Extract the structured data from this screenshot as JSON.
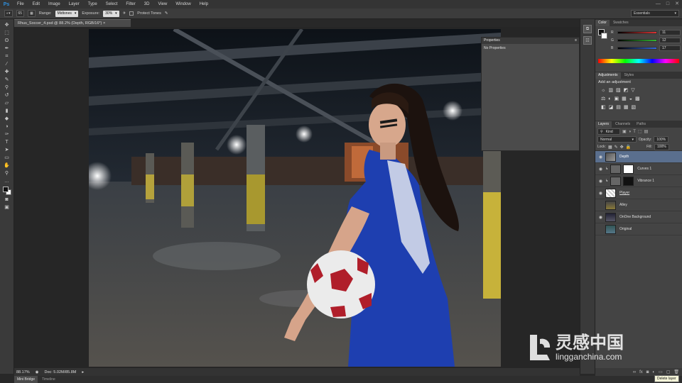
{
  "app": {
    "logo": "Ps"
  },
  "menu": [
    "File",
    "Edit",
    "Image",
    "Layer",
    "Type",
    "Select",
    "Filter",
    "3D",
    "View",
    "Window",
    "Help"
  ],
  "window_controls": [
    "—",
    "□",
    "✕"
  ],
  "options_bar": {
    "brush_size": "65",
    "range_label": "Range:",
    "range_value": "Midtones",
    "exposure_label": "Exposure:",
    "exposure_value": "30%",
    "protect_tones_label": "Protect Tones"
  },
  "workspace": "Essentials",
  "document_tab": "Rhus_Soccer_4.psd @ 88.2% (Depth, RGB/16*)",
  "status": {
    "zoom": "88.17%",
    "doc": "Doc: 5.02M/85.8M"
  },
  "bottom_tabs": [
    "Mini Bridge",
    "Timeline"
  ],
  "properties_panel": {
    "title": "Properties",
    "content": "No Properties"
  },
  "color_panel": {
    "tabs": [
      "Color",
      "Swatches"
    ],
    "channels": [
      {
        "name": "R",
        "value": "11",
        "color": "#d33"
      },
      {
        "name": "G",
        "value": "12",
        "color": "#3b3"
      },
      {
        "name": "B",
        "value": "17",
        "color": "#36d"
      }
    ]
  },
  "adjustments_panel": {
    "tabs": [
      "Adjustments",
      "Styles"
    ],
    "heading": "Add an adjustment",
    "row1": [
      "☼",
      "▥",
      "▨",
      "◩",
      "▽"
    ],
    "row2": [
      "⚖",
      "◐",
      "▣",
      "▦",
      "◒",
      "▩"
    ],
    "row3": [
      "◧",
      "◪",
      "▤",
      "▦",
      "▧"
    ]
  },
  "layers_panel": {
    "tabs": [
      "Layers",
      "Channels",
      "Paths"
    ],
    "filter": "Kind",
    "blend_mode": "Normal",
    "opacity_label": "Opacity:",
    "opacity": "100%",
    "lock_label": "Lock:",
    "fill_label": "Fill:",
    "fill": "100%",
    "layers": [
      {
        "name": "Depth",
        "selected": true,
        "visible": true
      },
      {
        "name": "Curves 1",
        "selected": false,
        "visible": true
      },
      {
        "name": "Vibrance 1",
        "selected": false,
        "visible": true
      },
      {
        "name": "Player",
        "selected": false,
        "visible": true
      },
      {
        "name": "Alley",
        "selected": false,
        "visible": false
      },
      {
        "name": "OnOne Background",
        "selected": false,
        "visible": true
      },
      {
        "name": "Original",
        "selected": false,
        "visible": false
      }
    ]
  },
  "tooltip": "Delete layer",
  "watermark": {
    "brand": "灵感中国",
    "url": "lingganchina.com"
  }
}
